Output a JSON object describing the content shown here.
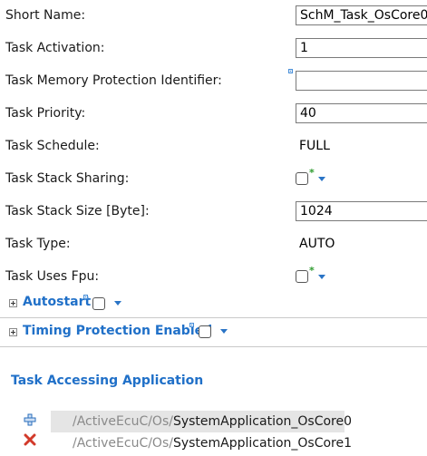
{
  "fields": [
    {
      "key": "short_name",
      "label": "Short Name:",
      "value": "SchM_Task_OsCore0"
    },
    {
      "key": "task_activation",
      "label": "Task Activation:",
      "value": "1"
    },
    {
      "key": "task_mem_prot",
      "label": "Task Memory Protection Identifier:",
      "value": ""
    },
    {
      "key": "task_priority",
      "label": "Task Priority:",
      "value": "40"
    },
    {
      "key": "task_schedule",
      "label": "Task Schedule:",
      "value": "FULL"
    },
    {
      "key": "task_stack_sharing",
      "label": "Task Stack Sharing:"
    },
    {
      "key": "task_stack_size",
      "label": "Task Stack Size [Byte]:",
      "value": "1024"
    },
    {
      "key": "task_type",
      "label": "Task Type:",
      "value": "AUTO"
    },
    {
      "key": "task_uses_fpu",
      "label": "Task Uses Fpu:"
    }
  ],
  "sections": [
    {
      "title": "Autostart",
      "checked": false
    },
    {
      "title": "Timing Protection Enabled",
      "checked": false
    }
  ],
  "accessing": {
    "heading": "Task Accessing Application",
    "items": [
      {
        "prefix": "/ActiveEcuC/Os/",
        "name": "SystemApplication_OsCore0",
        "selected": true
      },
      {
        "prefix": "/ActiveEcuC/Os/",
        "name": "SystemApplication_OsCore1",
        "selected": false
      }
    ]
  },
  "colors": {
    "accent": "#2070c8",
    "star": "#2e9b2e",
    "selection": "#e5e5e5",
    "delete": "#d23a2a"
  }
}
